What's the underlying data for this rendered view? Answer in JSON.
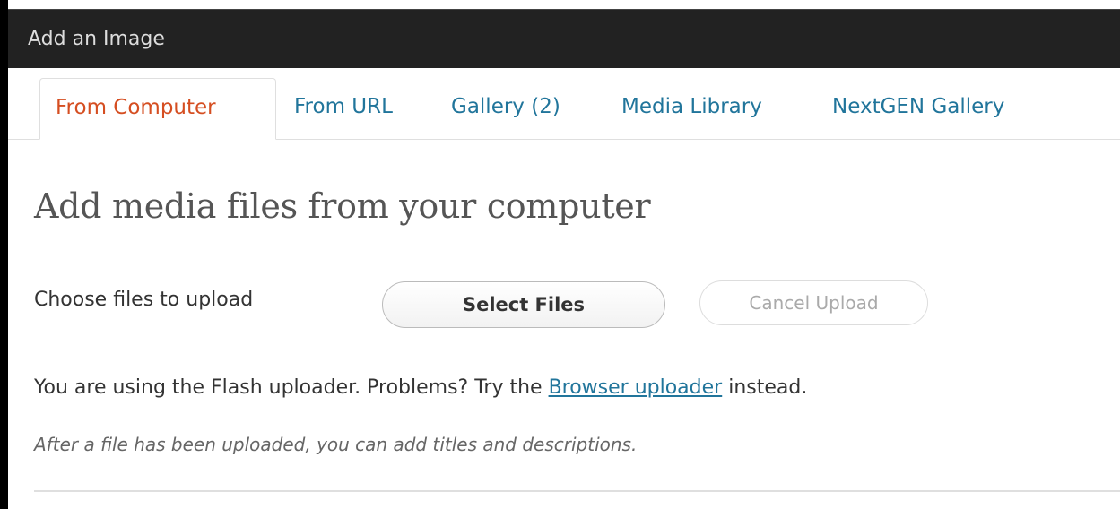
{
  "window": {
    "title": "Add an Image"
  },
  "tabs": [
    {
      "label": "From Computer",
      "active": true
    },
    {
      "label": "From URL",
      "active": false
    },
    {
      "label": "Gallery (2)",
      "active": false
    },
    {
      "label": "Media Library",
      "active": false
    },
    {
      "label": "NextGEN Gallery",
      "active": false
    }
  ],
  "main": {
    "heading": "Add media files from your computer",
    "choose_label": "Choose files to upload",
    "select_files_label": "Select Files",
    "cancel_upload_label": "Cancel Upload",
    "flash_prefix": "You are using the Flash uploader. Problems? Try the ",
    "browser_uploader_link": "Browser uploader",
    "flash_suffix": " instead.",
    "hint": "After a file has been uploaded, you can add titles and descriptions."
  },
  "colors": {
    "titlebar_bg": "#222222",
    "active_tab": "#d54e21",
    "link": "#21759b"
  }
}
